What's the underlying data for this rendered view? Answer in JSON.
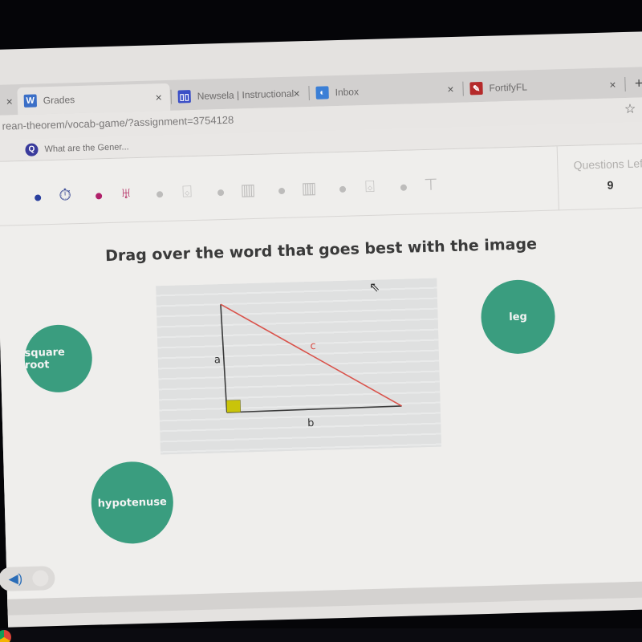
{
  "browser": {
    "tabs": [
      {
        "label": "Grades",
        "favicon": "W",
        "favicon_color": "#3b6fc7",
        "active": false
      },
      {
        "label": "Newsela | Instructional",
        "favicon": "▯▯",
        "favicon_color": "#3b4fc7",
        "active": false
      },
      {
        "label": "Inbox",
        "favicon": "◐",
        "favicon_color": "#3b7fd6",
        "active": false
      },
      {
        "label": "FortifyFL",
        "favicon": "✎",
        "favicon_color": "#b52a2a",
        "active": false
      }
    ],
    "close_glyph": "×",
    "new_tab_glyph": "+",
    "star_glyph": "☆",
    "url": "rean-theorem/vocab-game/?assignment=3754128",
    "bookmark": {
      "label": "What are the Gener...",
      "icon": "Q"
    }
  },
  "questions_left": {
    "label": "Questions Left",
    "value": "9"
  },
  "progress": {
    "steps": [
      {
        "type": "dot",
        "color": "#2a3f9e"
      },
      {
        "type": "stopwatch-icon",
        "color": "#2e3f8f"
      },
      {
        "type": "dot",
        "color": "#b0206a"
      },
      {
        "type": "goblet-icon",
        "color": "#b0205a"
      },
      {
        "type": "dot",
        "color": "#bdbcbb"
      },
      {
        "type": "drum-icon",
        "color": "#bdbcbb"
      },
      {
        "type": "dot",
        "color": "#bdbcbb"
      },
      {
        "type": "piano-icon",
        "color": "#bdbcbb"
      },
      {
        "type": "dot",
        "color": "#bdbcbb"
      },
      {
        "type": "piano-icon",
        "color": "#bdbcbb"
      },
      {
        "type": "dot",
        "color": "#bdbcbb"
      },
      {
        "type": "drum-icon",
        "color": "#bdbcbb"
      },
      {
        "type": "dot",
        "color": "#bdbcbb"
      },
      {
        "type": "cymbal-icon",
        "color": "#bdbcbb"
      }
    ]
  },
  "question": {
    "instruction": "Drag over the word that goes best with the image",
    "diagram": {
      "labels": {
        "a": "a",
        "b": "b",
        "c": "c"
      },
      "hypotenuse_color": "#d9524a",
      "leg_color": "#3a3a3a",
      "right_angle_color": "#c9c40a"
    }
  },
  "word_choices": [
    {
      "id": "square-root",
      "label": "square root"
    },
    {
      "id": "leg",
      "label": "leg"
    },
    {
      "id": "hypotenuse",
      "label": "hypotenuse"
    }
  ],
  "colors": {
    "bubble": "#3a9d7f"
  }
}
